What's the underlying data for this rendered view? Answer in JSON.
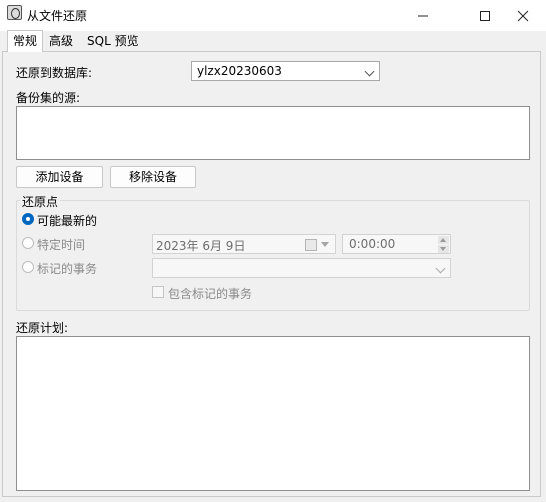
{
  "window": {
    "title": "从文件还原"
  },
  "tabs": [
    {
      "label": "常规",
      "active": true
    },
    {
      "label": "高级",
      "active": false
    },
    {
      "label": "SQL 预览",
      "active": false
    }
  ],
  "restore_db": {
    "label": "还原到数据库:",
    "value": "ylzx20230603"
  },
  "backup_source": {
    "label": "备份集的源:"
  },
  "buttons": {
    "add_device": "添加设备",
    "remove_device": "移除设备"
  },
  "restore_point": {
    "title": "还原点",
    "latest": "可能最新的",
    "specific_time": "特定时间",
    "date_value": "2023年  6月  9日",
    "time_value": "0:00:00",
    "marked_transaction": "标记的事务",
    "include_marked": "包含标记的事务"
  },
  "restore_plan": {
    "label": "还原计划:"
  },
  "colors": {
    "accent": "#0067c0"
  }
}
